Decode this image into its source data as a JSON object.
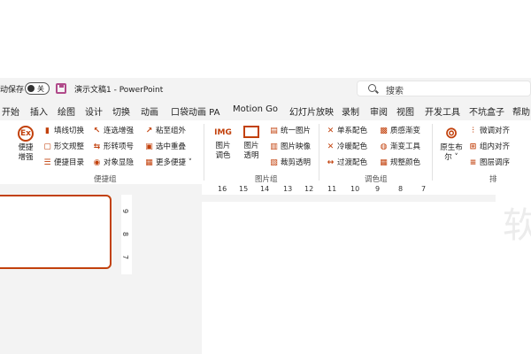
{
  "titlebar": {
    "autosave_label": "动保存",
    "autosave_state": "关",
    "document_title": "演示文稿1 - PowerPoint",
    "search_placeholder": "搜索"
  },
  "tabs": [
    "开始",
    "插入",
    "绘图",
    "设计",
    "切换",
    "动画",
    "口袋动画 PA",
    "Motion Go",
    "幻灯片放映",
    "录制",
    "审阅",
    "视图",
    "开发工具",
    "不坑盒子",
    "帮助"
  ],
  "ribbon": {
    "quick": {
      "big_label_1": "便捷",
      "big_label_2": "增强",
      "col1": [
        "填线切换",
        "形文规整",
        "便捷目录"
      ],
      "col2": [
        "连选增强",
        "形转项号",
        "对象显隐"
      ],
      "col3": [
        "粘至组外",
        "选中重叠",
        "更多便捷 ˅"
      ],
      "group_label": "便捷组"
    },
    "image": {
      "big1_glyph": "IMG",
      "big1_label_1": "图片",
      "big1_label_2": "调色",
      "big2_label_1": "图片",
      "big2_label_2": "透明",
      "col": [
        "统一图片",
        "图片映像",
        "裁剪透明"
      ],
      "group_label": "图片组"
    },
    "color": {
      "col1": [
        "单系配色",
        "冷暖配色",
        "过渡配色"
      ],
      "col2": [
        "质感渐变",
        "渐变工具",
        "规整颜色"
      ],
      "group_label": "调色组"
    },
    "layout": {
      "big_label_1": "原生布",
      "big_label_2": "尔 ˅",
      "col": [
        "微调对齐",
        "组内对齐",
        "图层调序"
      ],
      "group_label": "排"
    }
  },
  "rulers": {
    "horizontal": [
      "16",
      "15",
      "14",
      "13",
      "12",
      "11",
      "10",
      "9",
      "8",
      "7"
    ],
    "vertical": [
      "9",
      "8",
      "7"
    ]
  },
  "watermark": "软",
  "colors": {
    "accent": "#c2410c",
    "chrome_bg": "#f3f3f3",
    "save_icon": "#b04a8a"
  }
}
